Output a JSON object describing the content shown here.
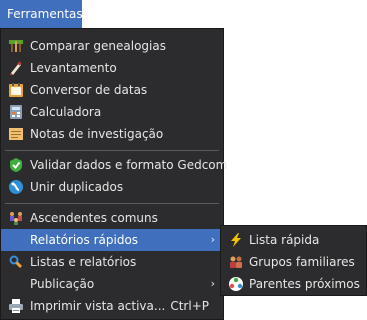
{
  "menubar": {
    "tools_label": "Ferramentas"
  },
  "menu": {
    "items": [
      {
        "label": "Comparar genealogias",
        "icon": "compare-trees-icon"
      },
      {
        "label": "Levantamento",
        "icon": "survey-icon"
      },
      {
        "label": "Conversor de datas",
        "icon": "date-converter-icon"
      },
      {
        "label": "Calculadora",
        "icon": "calculator-icon"
      },
      {
        "label": "Notas de investigação",
        "icon": "research-notes-icon"
      },
      {
        "label": "Validar dados e formato Gedcom",
        "icon": "validate-check-icon"
      },
      {
        "label": "Unir duplicados",
        "icon": "merge-duplicates-icon"
      },
      {
        "label": "Ascendentes comuns",
        "icon": "common-ancestors-icon"
      },
      {
        "label": "Relatórios rápidos",
        "icon": "",
        "arrow": "›"
      },
      {
        "label": "Listas e relatórios",
        "icon": "lists-reports-icon"
      },
      {
        "label": "Publicação",
        "icon": "",
        "arrow": "›"
      },
      {
        "label": "Imprimir vista activa...",
        "icon": "printer-icon",
        "shortcut": "Ctrl+P"
      }
    ]
  },
  "submenu": {
    "items": [
      {
        "label": "Lista rápida",
        "icon": "lightning-icon"
      },
      {
        "label": "Grupos familiares",
        "icon": "family-group-icon"
      },
      {
        "label": "Parentes próximos",
        "icon": "close-relatives-icon"
      }
    ]
  },
  "colors": {
    "menu_bg": "#2c2c2e",
    "highlight": "#3f6fbd",
    "text": "#e6e6e6"
  }
}
